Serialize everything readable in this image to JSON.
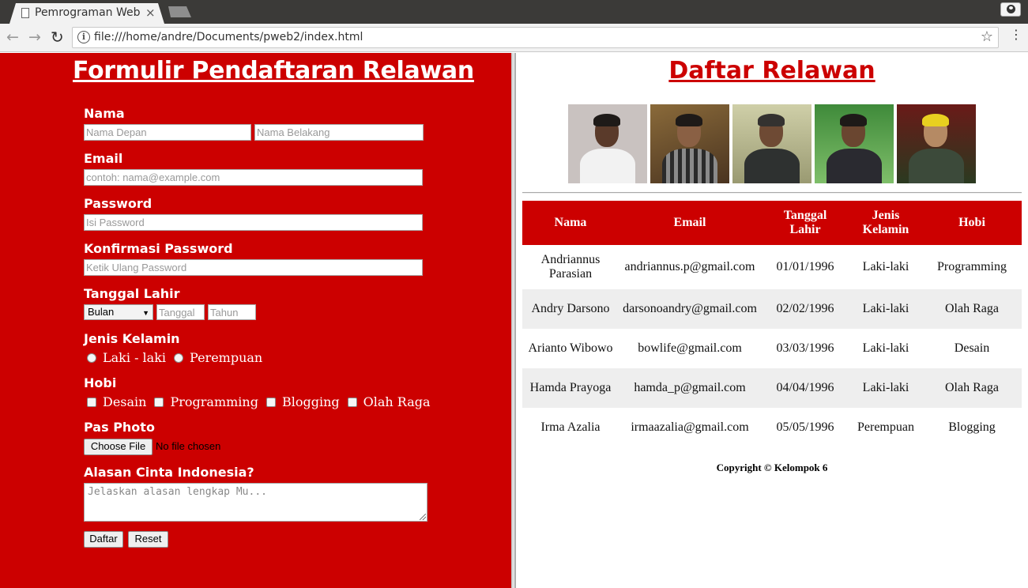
{
  "browser": {
    "tab_title": "Pemrograman Web",
    "tab_close": "×",
    "url": "file:///home/andre/Documents/pweb2/index.html",
    "back_icon": "arrow-left-icon",
    "forward_icon": "arrow-right-icon",
    "reload_icon": "reload-icon",
    "star_icon": "star-icon",
    "menu_icon": "kebab-menu-icon"
  },
  "form": {
    "title": "Formulir Pendaftaran Relawan",
    "nama_label": "Nama",
    "nama_depan_placeholder": "Nama Depan",
    "nama_belakang_placeholder": "Nama Belakang",
    "email_label": "Email",
    "email_placeholder": "contoh: nama@example.com",
    "password_label": "Password",
    "password_placeholder": "Isi Password",
    "konfirmasi_label": "Konfirmasi Password",
    "konfirmasi_placeholder": "Ketik Ulang Password",
    "tanggal_lahir_label": "Tanggal Lahir",
    "bulan_selected": "Bulan",
    "tanggal_placeholder": "Tanggal",
    "tahun_placeholder": "Tahun",
    "jenis_kelamin_label": "Jenis Kelamin",
    "gender_options": [
      "Laki - laki",
      "Perempuan"
    ],
    "hobi_label": "Hobi",
    "hobi_options": [
      "Desain",
      "Programming",
      "Blogging",
      "Olah Raga"
    ],
    "pas_photo_label": "Pas Photo",
    "choose_file_label": "Choose File",
    "no_file_text": "No file chosen",
    "alasan_label": "Alasan Cinta Indonesia?",
    "alasan_placeholder": "Jelaskan alasan lengkap Mu...",
    "daftar_button": "Daftar",
    "reset_button": "Reset",
    "accent_color": "#cc0000"
  },
  "list": {
    "title": "Daftar Relawan",
    "photos": [
      "photo-andriannus",
      "photo-andry",
      "photo-arianto",
      "photo-hamda",
      "photo-irma"
    ],
    "columns": [
      "Nama",
      "Email",
      "Tanggal Lahir",
      "Jenis Kelamin",
      "Hobi"
    ],
    "rows": [
      [
        "Andriannus Parasian",
        "andriannus.p@gmail.com",
        "01/01/1996",
        "Laki-laki",
        "Programming"
      ],
      [
        "Andry Darsono",
        "darsonoandry@gmail.com",
        "02/02/1996",
        "Laki-laki",
        "Olah Raga"
      ],
      [
        "Arianto Wibowo",
        "bowlife@gmail.com",
        "03/03/1996",
        "Laki-laki",
        "Desain"
      ],
      [
        "Hamda Prayoga",
        "hamda_p@gmail.com",
        "04/04/1996",
        "Laki-laki",
        "Olah Raga"
      ],
      [
        "Irma Azalia",
        "irmaazalia@gmail.com",
        "05/05/1996",
        "Perempuan",
        "Blogging"
      ]
    ],
    "copyright": "Copyright © Kelompok 6"
  }
}
